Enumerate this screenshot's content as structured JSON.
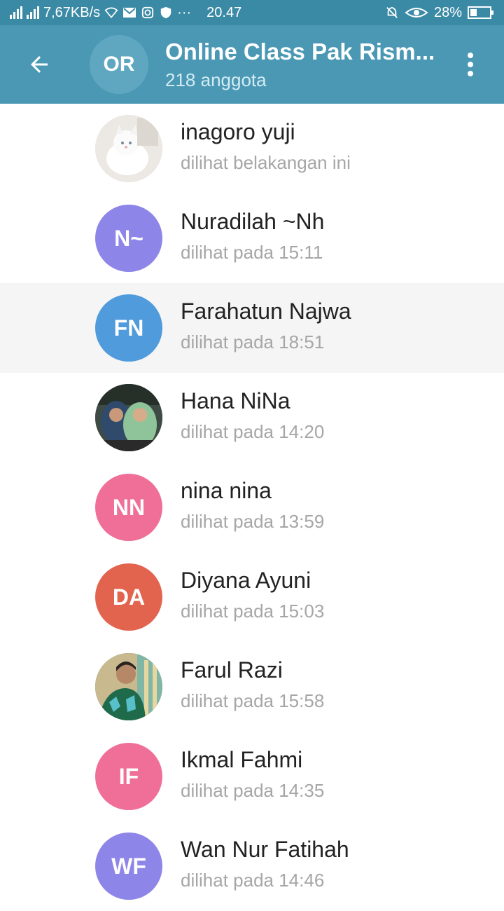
{
  "status": {
    "speed": "7,67KB/s",
    "time": "20.47",
    "battery": "28%"
  },
  "header": {
    "avatar_initials": "OR",
    "title": "Online Class Pak Rism...",
    "subtitle": "218 anggota",
    "back_icon": "arrow-back-icon",
    "menu_icon": "more-vert-icon"
  },
  "members": [
    {
      "name": "inagoro yuji",
      "seen": "dilihat belakangan ini",
      "initials": "",
      "color": "#e9e6e2",
      "photo": "cat"
    },
    {
      "name": "Nuradilah ~Nh",
      "seen": "dilihat pada 15:11",
      "initials": "N~",
      "color": "#8e85e8"
    },
    {
      "name": "Farahatun Najwa",
      "seen": "dilihat pada 18:51",
      "initials": "FN",
      "color": "#4f9bdc"
    },
    {
      "name": "Hana NiNa",
      "seen": "dilihat pada 14:20",
      "initials": "",
      "color": "#3c4a3e",
      "photo": "people"
    },
    {
      "name": "nina nina",
      "seen": "dilihat pada 13:59",
      "initials": "NN",
      "color": "#ef6f99"
    },
    {
      "name": "Diyana Ayuni",
      "seen": "dilihat pada 15:03",
      "initials": "DA",
      "color": "#e2644f"
    },
    {
      "name": "Farul Razi",
      "seen": "dilihat pada 15:58",
      "initials": "",
      "color": "#2c6e4d",
      "photo": "man"
    },
    {
      "name": "Ikmal Fahmi",
      "seen": "dilihat pada 14:35",
      "initials": "IF",
      "color": "#ef6f99"
    },
    {
      "name": "Wan Nur Fatihah",
      "seen": "dilihat pada 14:46",
      "initials": "WF",
      "color": "#8e85e8"
    }
  ]
}
